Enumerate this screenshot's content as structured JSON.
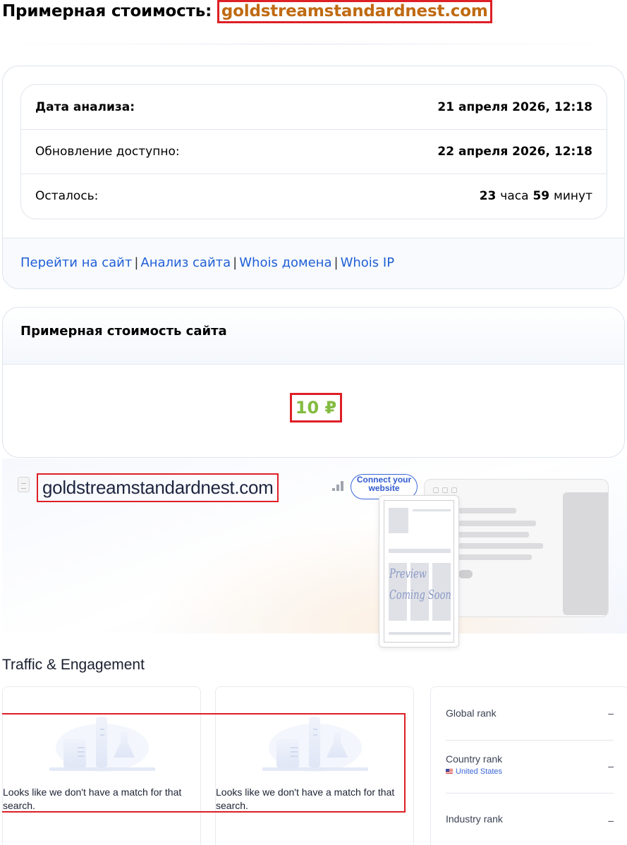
{
  "header": {
    "title_prefix": "Примерная стоимость:",
    "domain": "goldstreamstandardnest.com"
  },
  "analysis": {
    "rows": [
      {
        "label": "Дата анализа:",
        "value": "21 апреля 2026, 12:18"
      },
      {
        "label": "Обновление доступно:",
        "value": "22 апреля 2026, 12:18"
      }
    ],
    "remaining": {
      "label": "Осталось:",
      "hours": "23",
      "hours_unit": "часа",
      "minutes": "59",
      "minutes_unit": "минут"
    },
    "links": [
      "Перейти на сайт",
      "Анализ сайта",
      "Whois домена",
      "Whois IP"
    ]
  },
  "valuation": {
    "title": "Примерная стоимость сайта",
    "price": "10 ₽"
  },
  "similarweb": {
    "domain": "goldstreamstandardnest.com",
    "connect_label": "Connect your website",
    "preview_line1": "Preview",
    "preview_line2": "Coming Soon",
    "traffic_title": "Traffic & Engagement",
    "no_match_text": "Looks like we don't have a match for that search.",
    "ranks": [
      {
        "label": "Global rank",
        "value": "–"
      },
      {
        "label": "Country rank",
        "value": "–",
        "country": "United States"
      },
      {
        "label": "Industry rank",
        "value": "–"
      }
    ]
  },
  "colors": {
    "link": "#1f5fd6",
    "price": "#83bb40",
    "domain_title": "#c06a12",
    "highlight_box": "#dd1f26"
  }
}
